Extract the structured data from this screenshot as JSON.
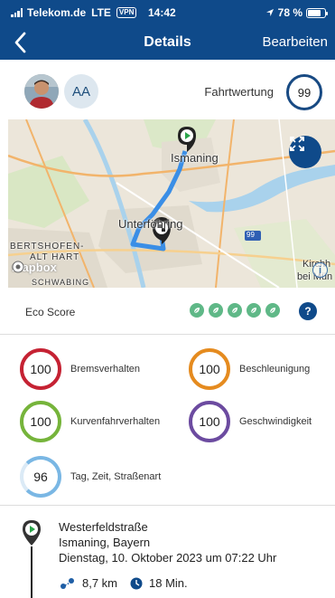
{
  "status_bar": {
    "carrier": "Telekom.de",
    "network": "LTE",
    "vpn": "VPN",
    "time": "14:42",
    "battery": "78 %",
    "battery_level": 0.78
  },
  "nav": {
    "title": "Details",
    "edit_label": "Bearbeiten"
  },
  "driver": {
    "initials": "AA",
    "rating_label": "Fahrtwertung",
    "rating_value": "99"
  },
  "map": {
    "labels": [
      "Ismaning",
      "Unterföhring",
      "BERTSHOFEN-",
      "ALT HART",
      "Kirchh",
      "bei Mün",
      "99",
      "SCHWABING"
    ],
    "attribution": "mapbox",
    "info_label": "i"
  },
  "eco_score": {
    "label": "Eco Score",
    "leaves": 5,
    "help_label": "?"
  },
  "scores": [
    {
      "value": "100",
      "label": "Bremsverhalten",
      "color": "#c52233"
    },
    {
      "value": "100",
      "label": "Beschleunigung",
      "color": "#e58b1f"
    },
    {
      "value": "100",
      "label": "Kurvenfahrverhalten",
      "color": "#76b43b"
    },
    {
      "value": "100",
      "label": "Geschwindigkeit",
      "color": "#6c4ba0"
    },
    {
      "value": "96",
      "label": "Tag, Zeit, Straßenart",
      "color": "#7ab7e4"
    }
  ],
  "trip": {
    "street": "Westerfeldstraße",
    "city": "Ismaning, Bayern",
    "date": "Dienstag, 10. Oktober 2023 um 07:22 Uhr",
    "distance": "8,7 km",
    "duration": "18 Min."
  },
  "colors": {
    "primary": "#0f4a8a",
    "route": "#3a8ee6",
    "leaf": "#5fb887"
  }
}
